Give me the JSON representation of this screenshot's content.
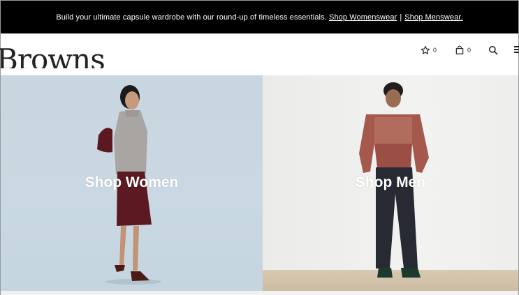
{
  "promo": {
    "text": "Build your ultimate capsule wardrobe with our round-up of timeless essentials.",
    "link_women": "Shop Womenswear",
    "separator": "|",
    "link_men": "Shop Menswear."
  },
  "header": {
    "logo": "Browns",
    "wishlist_count": "0",
    "bag_count": "0",
    "icons": [
      "star-icon",
      "bag-icon",
      "search-icon",
      "menu-icon"
    ]
  },
  "hero": {
    "women_label": "Shop Women",
    "men_label": "Shop Men"
  }
}
